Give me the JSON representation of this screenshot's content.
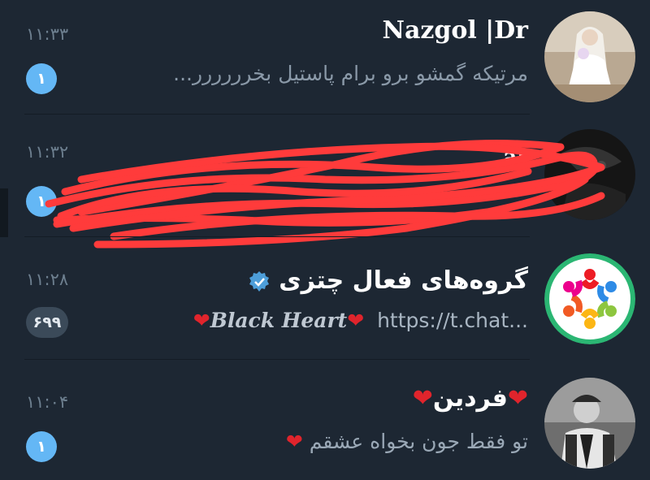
{
  "chats": [
    {
      "name": "Nazgol |Dr",
      "time": "۱۱:۳۳",
      "message": "مرتیکه گمشو برو برام پاستیل بخرررررر...",
      "unread": "۱",
      "avatar": "bride-photo-icon"
    },
    {
      "name": "ar",
      "time": "۱۱:۳۲",
      "message": "",
      "unread": "۱",
      "avatar": "dark-photo-icon",
      "scribbled": true
    },
    {
      "name": "گروه‌های فعال چتزی",
      "time": "۱۱:۲۸",
      "message_prefix": "https://t.chat...",
      "message_suffix": "Black Heart",
      "unread": "۶۹۹",
      "verified": true,
      "avatar": "colorful-people-circle-icon"
    },
    {
      "name": "فردین",
      "time": "۱۱:۰۴",
      "message": "تو فقط جون بخواه عشقم",
      "unread": "۱",
      "avatar": "boy-photo-icon"
    }
  ],
  "colors": {
    "background": "#1d2733",
    "badge_blue": "#64b7f5",
    "badge_muted": "#3b4a59",
    "scribble": "#ff3b3b"
  }
}
